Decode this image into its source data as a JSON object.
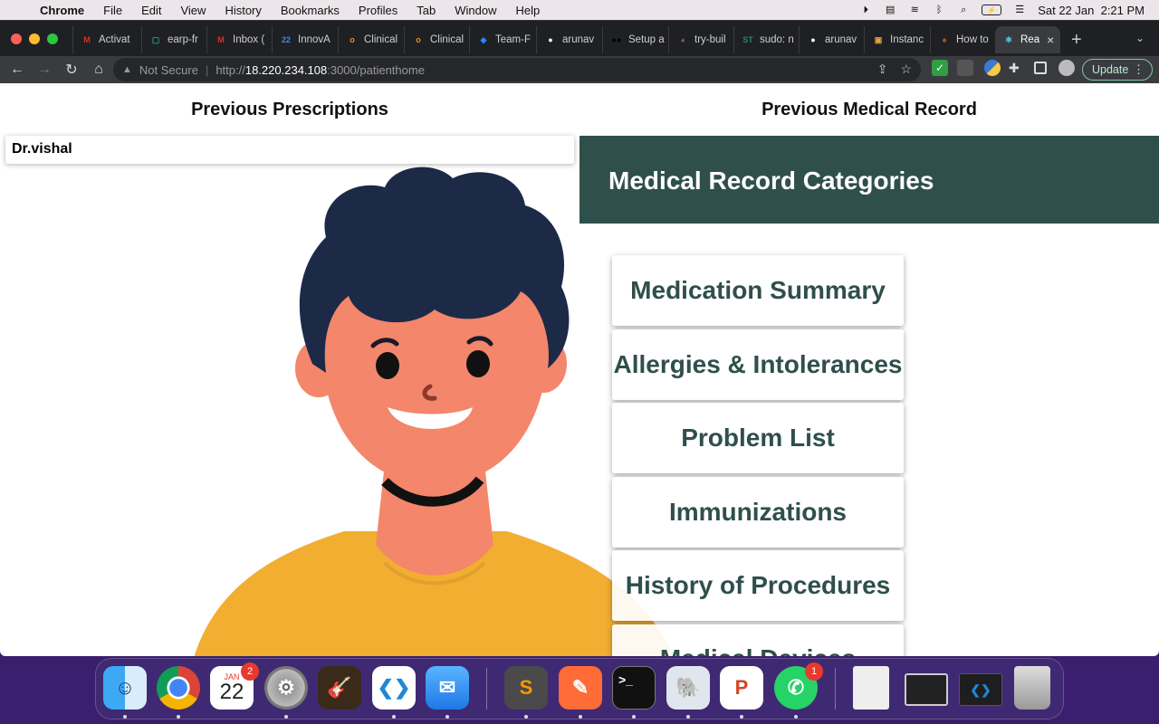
{
  "menubar": {
    "apple": "",
    "app": "Chrome",
    "items": [
      "File",
      "Edit",
      "View",
      "History",
      "Bookmarks",
      "Profiles",
      "Tab",
      "Window",
      "Help"
    ],
    "datetime": "Sat 22 Jan  2:21 PM",
    "icons": [
      "screen-record-icon",
      "display-icon",
      "wifi-icon",
      "bluetooth-icon",
      "search-icon",
      "battery-icon",
      "control-center-icon"
    ]
  },
  "tabs": [
    {
      "title": "Activat",
      "icon": "gmail-icon",
      "color": "#d93025",
      "glyph": "M"
    },
    {
      "title": "earp-fr",
      "icon": "sheet-icon",
      "color": "#2b9a8a",
      "glyph": "▢"
    },
    {
      "title": "Inbox (",
      "icon": "gmail-icon",
      "color": "#d93025",
      "glyph": "M"
    },
    {
      "title": "InnovA",
      "icon": "calendar-icon",
      "color": "#4285f4",
      "glyph": "22"
    },
    {
      "title": "Clinical",
      "icon": "openemr-icon",
      "color": "#f08a24",
      "glyph": "o"
    },
    {
      "title": "Clinical",
      "icon": "openemr-icon",
      "color": "#f08a24",
      "glyph": "o"
    },
    {
      "title": "Team-F",
      "icon": "jira-icon",
      "color": "#2684ff",
      "glyph": "◆"
    },
    {
      "title": "arunav",
      "icon": "github-icon",
      "color": "#ffffff",
      "glyph": "●"
    },
    {
      "title": "Setup a",
      "icon": "medium-icon",
      "color": "#000000",
      "glyph": "●●"
    },
    {
      "title": "try-buil",
      "icon": "profile-icon",
      "color": "#8a6a4a",
      "glyph": "◕"
    },
    {
      "title": "sudo: n",
      "icon": "stackexchange-icon",
      "color": "#1a8a6a",
      "glyph": "ST"
    },
    {
      "title": "arunav",
      "icon": "github-icon",
      "color": "#ffffff",
      "glyph": "●"
    },
    {
      "title": "Instanc",
      "icon": "aws-icon",
      "color": "#e8a33c",
      "glyph": "▣"
    },
    {
      "title": "How to",
      "icon": "blog-icon",
      "color": "#c0552b",
      "glyph": "♠"
    },
    {
      "title": "Rea",
      "icon": "react-icon",
      "color": "#61dafb",
      "glyph": "⚛"
    }
  ],
  "address": {
    "security": "Not Secure",
    "protocol": "http://",
    "host": "18.220.234.108",
    "path": ":3000/patienthome"
  },
  "update_label": "Update",
  "page": {
    "prescriptions_heading": "Previous Prescriptions",
    "medical_heading": "Previous Medical Record",
    "prescriptions": [
      "Dr.vishal"
    ],
    "categories_title": "Medical Record Categories",
    "categories": [
      "Medication Summary",
      "Allergies & Intolerances",
      "Problem List",
      "Immunizations",
      "History of Procedures",
      "Medical Devices"
    ]
  },
  "dock": {
    "calendar_month": "JAN",
    "calendar_day": "22",
    "calendar_badge": "2",
    "whatsapp_badge": "1",
    "apps": [
      "finder-icon",
      "chrome-icon",
      "calendar-icon",
      "system-preferences-icon",
      "garageband-icon",
      "vscode-icon",
      "mail-icon",
      "sublime-text-icon",
      "postman-icon",
      "terminal-icon",
      "pgadmin-icon",
      "powerpoint-icon",
      "whatsapp-icon",
      "documents-icon",
      "screenshot-icon",
      "vscode-window-icon",
      "trash-icon"
    ]
  },
  "colors": {
    "accent": "#2f4f4b",
    "hair": "#1c2a48",
    "skin": "#f3866b",
    "shirt": "#f2ae31"
  }
}
